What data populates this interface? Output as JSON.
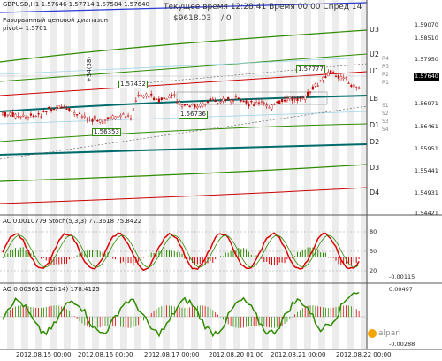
{
  "header": {
    "symbol_line": "GBPUSD,H1  1.57646 1.57714 1.57584 1.57640",
    "indicator_name": "Разорванный ценовой диапазон",
    "pivot_label": "pivot= 1.5701",
    "server_time": "Текущее время 12:28:41 Время 00:00 Спред 14",
    "balance": "$9618.03",
    "spread_note": "/ 0"
  },
  "level_labels": [
    "U3",
    "U2",
    "U1",
    "LB",
    "D1",
    "D2",
    "D3",
    "D4"
  ],
  "price_scale": [
    "1.59070",
    "1.58510",
    "1.57950",
    "1.57640",
    "1.56971",
    "1.56461",
    "1.55951",
    "1.55441",
    "1.54931",
    "1.54421"
  ],
  "current_price": "1.57640",
  "annotations": {
    "high_1": "1.57432",
    "high_2": "1.57777",
    "low_1": "1.56353",
    "low_2": "1.56736",
    "pips_note": "+34(38)",
    "r_labels": [
      "R4",
      "R3",
      "R2",
      "R1",
      "S1",
      "S2",
      "S3",
      "S4"
    ]
  },
  "ac_stoch_panel": {
    "title": "AC 0.0010779  Stoch(5,3,3) 77.3618 75.8422",
    "scale": [
      "80",
      "50",
      "20",
      "-0.00115"
    ]
  },
  "ao_cci_panel": {
    "title": "AO 0.003615  CCI(14) 178.4125",
    "scale": [
      "0.00497",
      "-0.00288"
    ]
  },
  "time_axis": [
    "2012.08.15 00:00",
    "2012.08.16 00:00",
    "2012.08.17 00:00",
    "2012.08.20 01:00",
    "2012.08.21 00:00",
    "2012.08.22 00:00"
  ],
  "brand": "alpari",
  "colors": {
    "candle": "#c00000",
    "level_green": "#2e8b00",
    "level_red": "#cc0000",
    "teal": "#006b6b",
    "stoch_green": "#2e8b00",
    "stoch_red": "#dd0000",
    "cci_green": "#2e8b00",
    "price_tag_bg": "#000000"
  },
  "icons": {
    "brand_logo": "alpari-logo-icon"
  }
}
